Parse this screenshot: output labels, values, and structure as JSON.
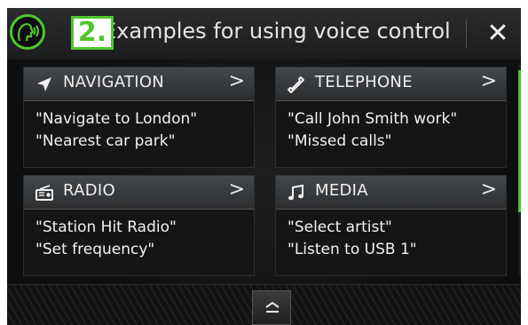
{
  "header": {
    "step": "2.",
    "title": "Examples for using voice control",
    "close_label": "✕"
  },
  "tiles": [
    {
      "title": "NAVIGATION",
      "icon": "navigation-arrow-icon",
      "chevron": ">",
      "lines": [
        "\"Navigate to London\"",
        "\"Nearest car park\""
      ]
    },
    {
      "title": "TELEPHONE",
      "icon": "phone-handset-icon",
      "chevron": ">",
      "lines": [
        "\"Call John Smith work\"",
        "\"Missed calls\""
      ]
    },
    {
      "title": "RADIO",
      "icon": "radio-icon",
      "chevron": ">",
      "lines": [
        "\"Station Hit Radio\"",
        "\"Set frequency\""
      ]
    },
    {
      "title": "MEDIA",
      "icon": "music-note-icon",
      "chevron": ">",
      "lines": [
        "\"Select artist\"",
        "\"Listen to USB 1\""
      ]
    }
  ],
  "colors": {
    "accent": "#4fc62d",
    "background": "#0d0e0f",
    "text": "#f0f0f0"
  }
}
